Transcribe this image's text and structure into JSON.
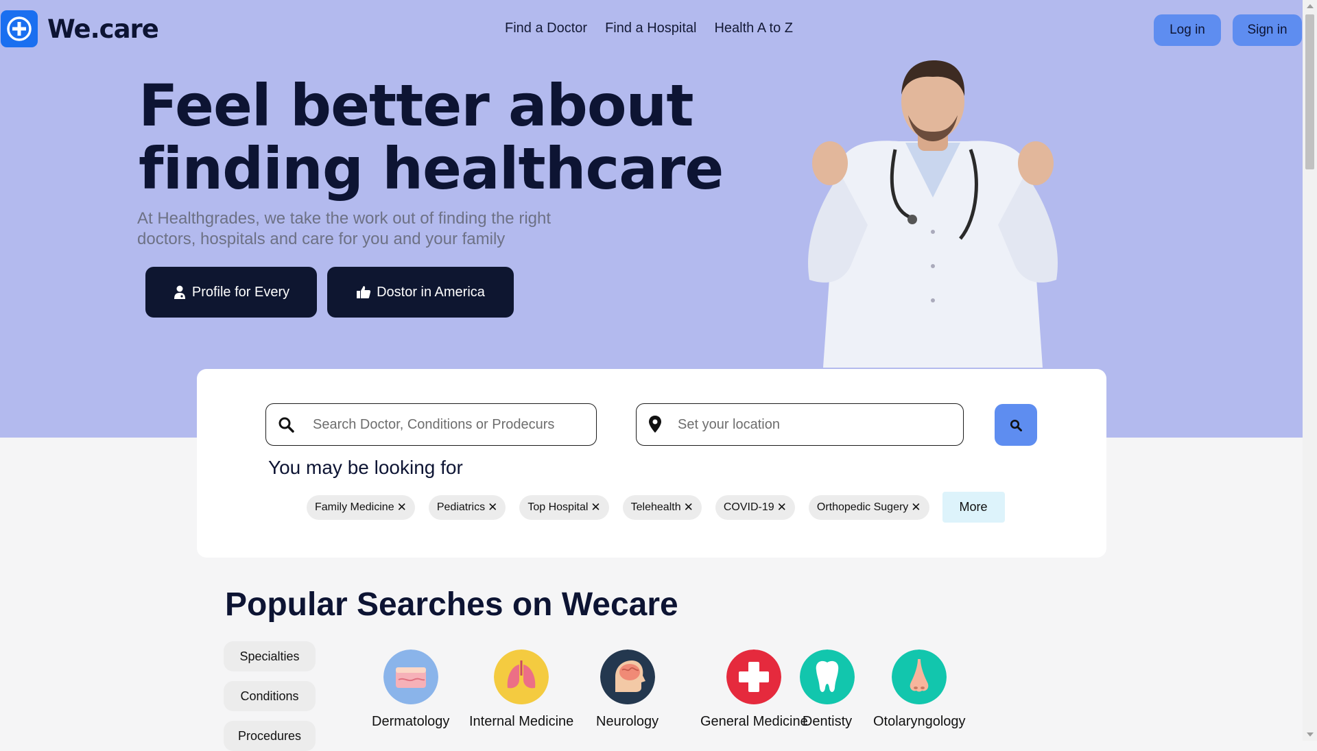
{
  "header": {
    "logo_text": "We.care",
    "nav": [
      "Find a Doctor",
      "Find a Hospital",
      "Health A to Z"
    ],
    "login_label": "Log in",
    "signin_label": "Sign in"
  },
  "hero": {
    "title_line1": "Feel better about",
    "title_line2": "finding healthcare",
    "subtitle_line1": "At Healthgrades, we take the work out of finding the right",
    "subtitle_line2": "doctors, hospitals and care for you and your family",
    "cta1_label": "Profile for Every",
    "cta2_label": "Dostor in America"
  },
  "search": {
    "query_placeholder": "Search Doctor, Conditions or Prodecurs",
    "location_placeholder": "Set your location",
    "looking_title": "You may be looking for",
    "chips": [
      "Family Medicine",
      "Pediatrics",
      "Top Hospital",
      "Telehealth",
      "COVID-19",
      "Orthopedic Sugery"
    ],
    "more_label": "More"
  },
  "popular": {
    "title": "Popular Searches on Wecare",
    "tabs": [
      "Specialties",
      "Conditions",
      "Procedures"
    ],
    "specialties": [
      {
        "label": "Dermatology",
        "icon": "skin-icon"
      },
      {
        "label": "Internal Medicine",
        "icon": "lungs-icon"
      },
      {
        "label": "Neurology",
        "icon": "brain-icon"
      },
      {
        "label": "General Medicine",
        "icon": "medical-cross-icon"
      },
      {
        "label": "Dentisty",
        "icon": "tooth-icon"
      },
      {
        "label": "Otolaryngology",
        "icon": "nose-icon"
      }
    ]
  },
  "colors": {
    "hero_bg": "#b3baee",
    "accent": "#5e8df0",
    "dark": "#0e1630",
    "logo_blue": "#1a6ff0"
  }
}
